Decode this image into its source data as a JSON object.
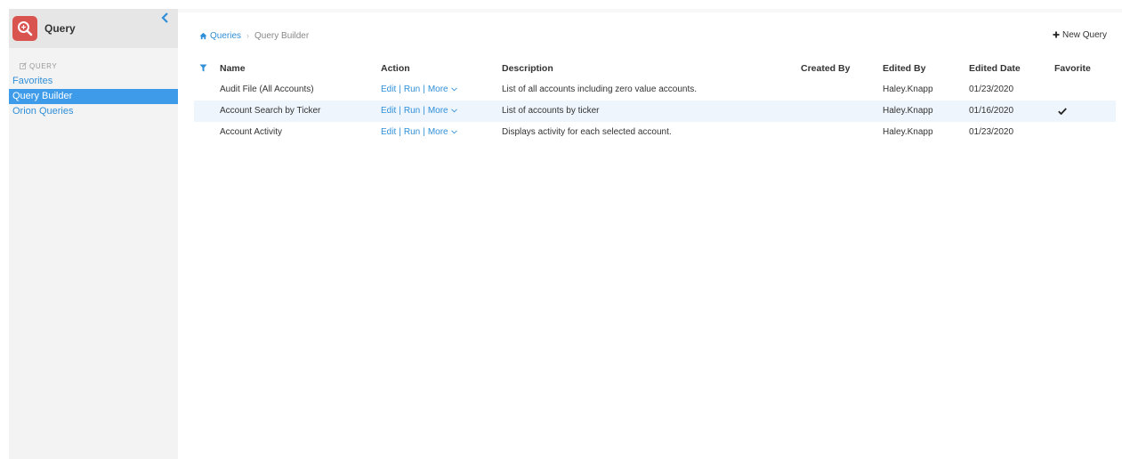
{
  "app": {
    "title": "Query",
    "logo_color": "#d9534f"
  },
  "sidebar": {
    "section_label": "QUERY",
    "items": [
      {
        "label": "Favorites",
        "active": false
      },
      {
        "label": "Query Builder",
        "active": true
      },
      {
        "label": "Orion Queries",
        "active": false
      }
    ]
  },
  "breadcrumb": {
    "home_icon": "home-icon",
    "link": "Queries",
    "separator": "›",
    "current": "Query Builder"
  },
  "toolbar": {
    "new_query_label": "New Query"
  },
  "table": {
    "columns": {
      "name": "Name",
      "action": "Action",
      "description": "Description",
      "created_by": "Created By",
      "edited_by": "Edited By",
      "edited_date": "Edited Date",
      "favorite": "Favorite"
    },
    "actions": {
      "edit": "Edit",
      "run": "Run",
      "more": "More",
      "separator": "|"
    },
    "rows": [
      {
        "name": "Audit File (All Accounts)",
        "description": "List of all accounts including zero value accounts.",
        "created_by": "",
        "edited_by": "Haley.Knapp",
        "edited_date": "01/23/2020",
        "favorite": false
      },
      {
        "name": "Account Search by Ticker",
        "description": "List of accounts by ticker",
        "created_by": "",
        "edited_by": "Haley.Knapp",
        "edited_date": "01/16/2020",
        "favorite": true
      },
      {
        "name": "Account Activity",
        "description": "Displays activity for each selected account.",
        "created_by": "",
        "edited_by": "Haley.Knapp",
        "edited_date": "01/23/2020",
        "favorite": false
      }
    ]
  },
  "colors": {
    "accent": "#2f8fd8",
    "active_nav": "#3d9be9",
    "row_highlight": "#eef5fc"
  }
}
